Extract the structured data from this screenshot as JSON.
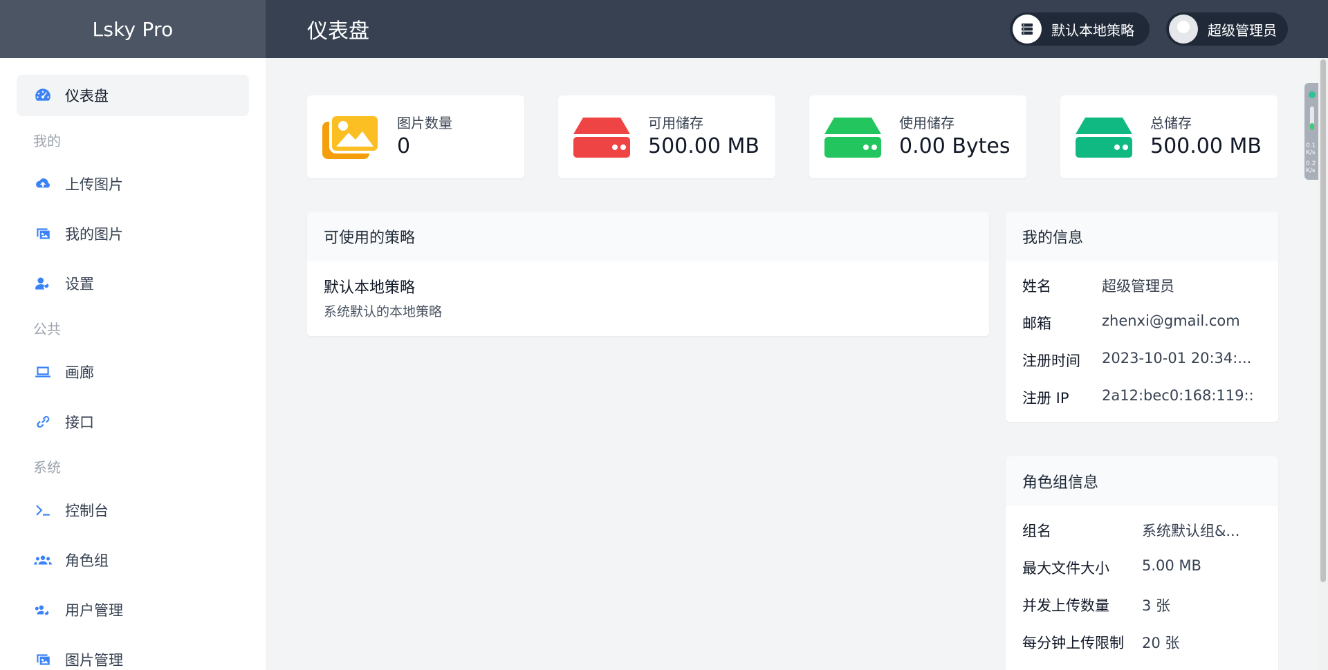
{
  "app": {
    "brand": "Lsky Pro"
  },
  "header": {
    "title": "仪表盘",
    "strategy_label": "默认本地策略",
    "user_label": "超级管理员"
  },
  "sidebar": {
    "dashboard": "仪表盘",
    "section_mine": "我的",
    "upload": "上传图片",
    "my_images": "我的图片",
    "settings": "设置",
    "section_public": "公共",
    "gallery": "画廊",
    "api": "接口",
    "section_system": "系统",
    "console": "控制台",
    "roles": "角色组",
    "users": "用户管理",
    "images_manage": "图片管理"
  },
  "stats": [
    {
      "label": "图片数量",
      "value": "0",
      "color": "#f59e0b"
    },
    {
      "label": "可用储存",
      "value": "500.00 MB",
      "color": "#ef4444"
    },
    {
      "label": "使用储存",
      "value": "0.00 Bytes",
      "color": "#22c55e"
    },
    {
      "label": "总储存",
      "value": "500.00 MB",
      "color": "#10b981"
    }
  ],
  "strategies": {
    "title": "可使用的策略",
    "name": "默认本地策略",
    "desc": "系统默认的本地策略"
  },
  "my_info": {
    "title": "我的信息",
    "rows": [
      {
        "k": "姓名",
        "v": "超级管理员"
      },
      {
        "k": "邮箱",
        "v": "zhenxi@gmail.com"
      },
      {
        "k": "注册时间",
        "v": "2023-10-01 20:34:..."
      },
      {
        "k": "注册 IP",
        "v": "2a12:bec0:168:119::"
      }
    ]
  },
  "role_info": {
    "title": "角色组信息",
    "rows": [
      {
        "k": "组名",
        "v": "系统默认组&..."
      },
      {
        "k": "最大文件大小",
        "v": "5.00 MB"
      },
      {
        "k": "并发上传数量",
        "v": "3 张"
      },
      {
        "k": "每分钟上传限制",
        "v": "20 张"
      }
    ]
  },
  "widget": {
    "line1": "0.1",
    "line2": "0.2",
    "unit": "K/s"
  }
}
